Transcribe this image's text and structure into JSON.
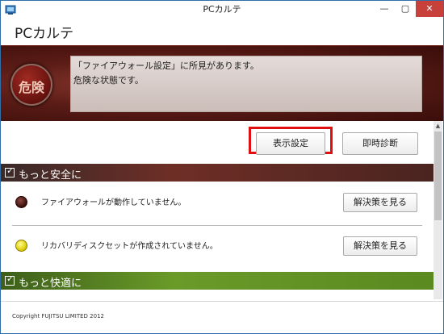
{
  "window": {
    "title": "PCカルテ",
    "minimize": "—",
    "maximize": "▢",
    "close": "✕"
  },
  "header": {
    "app_title": "PCカルテ"
  },
  "alert": {
    "badge": "危険",
    "line1": "「ファイアウォール設定」に所見があります。",
    "line2": "危険な状態です。"
  },
  "actions": {
    "display_settings": "表示設定",
    "instant_diagnosis": "即時診断"
  },
  "sections": {
    "safe": {
      "title": "もっと安全に",
      "check": "✓"
    },
    "comfort": {
      "title": "もっと快適に",
      "check": "✓"
    }
  },
  "issues": [
    {
      "text": "ファイアウォールが動作していません。",
      "button": "解決策を見る",
      "status": "danger"
    },
    {
      "text": "リカバリディスクセットが作成されていません。",
      "button": "解決策を見る",
      "status": "warning"
    }
  ],
  "scroll": {
    "up": "▲"
  },
  "footer": {
    "copyright": "Copyright FUJITSU LIMITED 2012"
  },
  "colors": {
    "close_button": "#c7403a",
    "highlight_frame": "#e01010",
    "danger_section": "#6e2e26",
    "comfort_section": "#6a9a28"
  },
  "icons": {
    "app": "pc-karte-app-icon",
    "section": "checkbox-icon",
    "danger_dot": "red-status-icon",
    "warning_dot": "yellow-status-icon"
  }
}
